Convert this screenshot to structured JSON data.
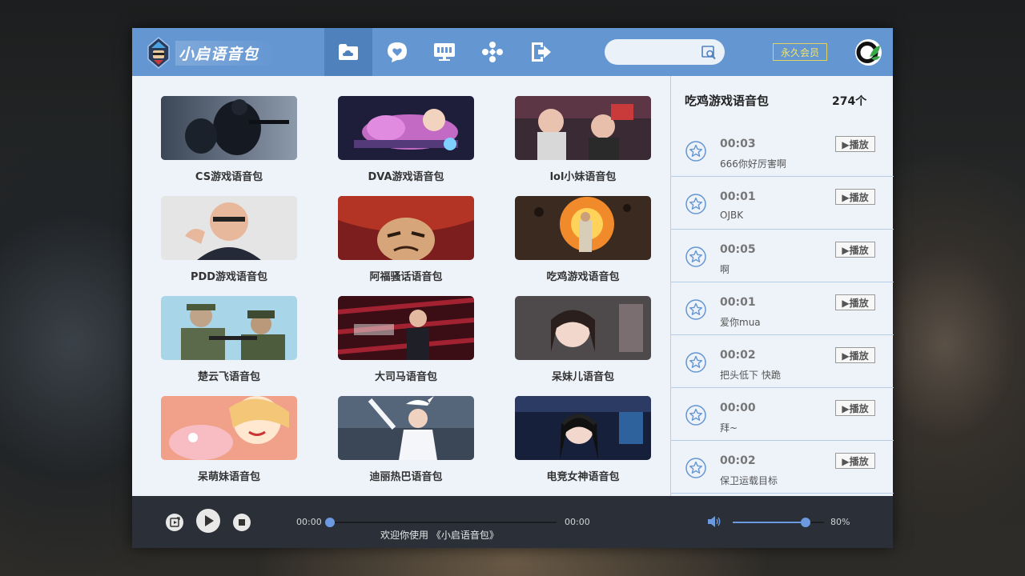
{
  "app": {
    "logo_text": "小启语音包",
    "vip_label": "永久会员",
    "accent": "#6496d2",
    "active_tab_color": "#4f81bd"
  },
  "nav": [
    {
      "icon": "cloud-folder-icon",
      "active": true
    },
    {
      "icon": "heart-chat-icon",
      "active": false
    },
    {
      "icon": "monitor-icon",
      "active": false
    },
    {
      "icon": "gamepad-icon",
      "active": false
    },
    {
      "icon": "exit-icon",
      "active": false
    }
  ],
  "search": {
    "value": "",
    "placeholder": ""
  },
  "grid": {
    "items": [
      {
        "label": "CS游戏语音包"
      },
      {
        "label": "DVA游戏语音包"
      },
      {
        "label": "lol小妹语音包"
      },
      {
        "label": "PDD游戏语音包"
      },
      {
        "label": "阿福骚话语音包"
      },
      {
        "label": "吃鸡游戏语音包"
      },
      {
        "label": "楚云飞语音包"
      },
      {
        "label": "大司马语音包"
      },
      {
        "label": "呆妹儿语音包"
      },
      {
        "label": "呆萌妹语音包"
      },
      {
        "label": "迪丽热巴语音包"
      },
      {
        "label": "电竞女神语音包"
      }
    ]
  },
  "sidebar": {
    "title": "吃鸡游戏语音包",
    "count": "274个",
    "play_label": "▶播放",
    "items": [
      {
        "duration": "00:03",
        "name": "666你好厉害啊"
      },
      {
        "duration": "00:01",
        "name": "OJBK"
      },
      {
        "duration": "00:05",
        "name": "啊"
      },
      {
        "duration": "00:01",
        "name": "爱你mua"
      },
      {
        "duration": "00:02",
        "name": "把头低下 快跪"
      },
      {
        "duration": "00:00",
        "name": "拜~"
      },
      {
        "duration": "00:02",
        "name": "保卫运载目标"
      }
    ]
  },
  "player": {
    "time_current": "00:00",
    "time_total": "00:00",
    "progress_fraction": 0,
    "welcome": "欢迎你使用 《小启语音包》",
    "volume_percent": 80,
    "volume_label": "80%"
  }
}
